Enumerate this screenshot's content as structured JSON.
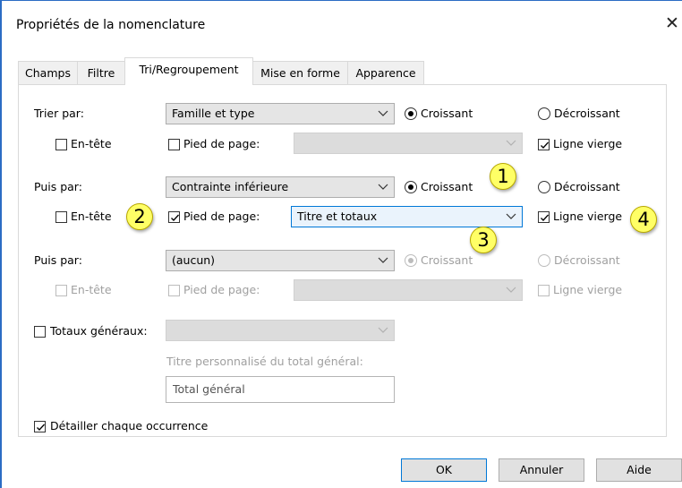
{
  "dialog": {
    "title": "Propriétés de la nomenclature"
  },
  "tabs": [
    {
      "label": "Champs"
    },
    {
      "label": "Filtre"
    },
    {
      "label": "Tri/Regroupement"
    },
    {
      "label": "Mise en forme"
    },
    {
      "label": "Apparence"
    }
  ],
  "sort1": {
    "label": "Trier par:",
    "value": "Famille et type",
    "asc": "Croissant",
    "desc": "Décroissant",
    "header": "En-tête",
    "footer": "Pied de page:",
    "footer_value": "",
    "blank": "Ligne vierge"
  },
  "sort2": {
    "label": "Puis par:",
    "value": "Contrainte inférieure",
    "asc": "Croissant",
    "desc": "Décroissant",
    "header": "En-tête",
    "footer": "Pied de page:",
    "footer_value": "Titre et totaux",
    "blank": "Ligne vierge"
  },
  "sort3": {
    "label": "Puis par:",
    "value": "(aucun)",
    "asc": "Croissant",
    "desc": "Décroissant",
    "header": "En-tête",
    "footer": "Pied de page:",
    "footer_value": "",
    "blank": "Ligne vierge"
  },
  "totals": {
    "label": "Totaux généraux:",
    "value": "",
    "custom_title_label": "Titre personnalisé du total général:",
    "custom_title_value": "Total général"
  },
  "detail": {
    "label": "Détailler chaque occurrence"
  },
  "buttons": {
    "ok": "OK",
    "cancel": "Annuler",
    "help": "Aide"
  },
  "annotations": [
    "1",
    "2",
    "3",
    "4"
  ],
  "colors": {
    "accent": "#0078d7",
    "badge": "#ffff66",
    "window_border": "#2b6cc4"
  }
}
